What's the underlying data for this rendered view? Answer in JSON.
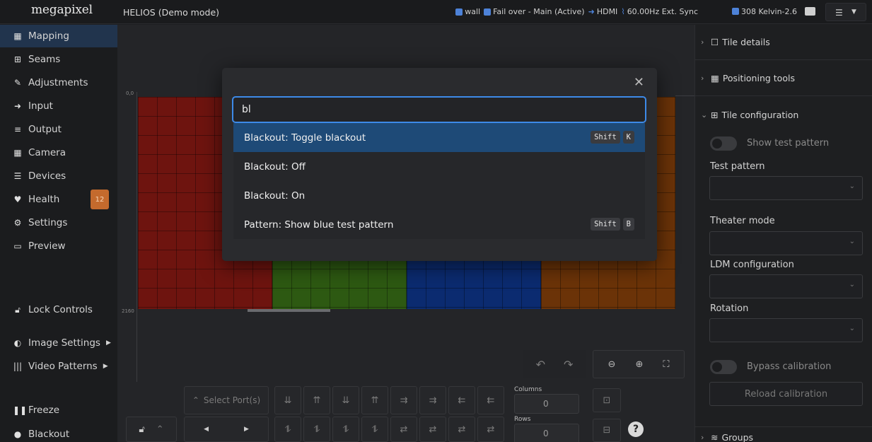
{
  "topbar": {
    "logo": "megapixel",
    "title": "HELIOS (Demo mode)",
    "status": {
      "wall": "wall",
      "failover": "Fail over - Main (Active)",
      "input": "HDMI",
      "sync": "60.00Hz Ext. Sync",
      "color_temp": "308 Kelvin-2.6"
    }
  },
  "sidebar": {
    "items": [
      {
        "label": "Mapping",
        "icon": "grid-icon"
      },
      {
        "label": "Seams",
        "icon": "plus-box-icon"
      },
      {
        "label": "Adjustments",
        "icon": "brush-icon"
      },
      {
        "label": "Input",
        "icon": "sign-in-icon"
      },
      {
        "label": "Output",
        "icon": "sliders-icon"
      },
      {
        "label": "Camera",
        "icon": "camera-grid-icon"
      },
      {
        "label": "Devices",
        "icon": "list-icon"
      },
      {
        "label": "Health",
        "icon": "heart-icon",
        "badge": "12"
      },
      {
        "label": "Settings",
        "icon": "gears-icon"
      },
      {
        "label": "Preview",
        "icon": "monitor-icon"
      }
    ],
    "lock_controls": "Lock Controls",
    "image_settings": "Image Settings",
    "video_patterns": "Video Patterns",
    "freeze": "Freeze",
    "blackout": "Blackout"
  },
  "canvas": {
    "ruler_top": "0,0",
    "ruler_bottom": "2160",
    "select_ports": "Select Port(s)",
    "columns_label": "Columns",
    "columns_value": "0",
    "rows_label": "Rows",
    "rows_value": "0",
    "help": "?"
  },
  "palette": {
    "query": "bl",
    "results": [
      {
        "label": "Blackout: Toggle blackout",
        "keys": [
          "Shift",
          "K"
        ],
        "selected": true
      },
      {
        "label": "Blackout: Off",
        "keys": [],
        "selected": false
      },
      {
        "label": "Blackout: On",
        "keys": [],
        "selected": false
      },
      {
        "label": "Pattern: Show blue test pattern",
        "keys": [
          "Shift",
          "B"
        ],
        "selected": false
      }
    ],
    "close": "✕"
  },
  "right_panel": {
    "tile_details": "Tile details",
    "positioning_tools": "Positioning tools",
    "tile_configuration": "Tile configuration",
    "show_test_pattern": "Show test pattern",
    "test_pattern": "Test pattern",
    "theater_mode": "Theater mode",
    "ldm_configuration": "LDM configuration",
    "rotation": "Rotation",
    "bypass_calibration": "Bypass calibration",
    "reload_calibration": "Reload calibration",
    "groups": "Groups"
  },
  "colors": {
    "accent": "#3d8ae8",
    "selected_row": "#1e4a77",
    "badge": "#c46a2d",
    "wall_red": "#7a1510",
    "wall_green": "#2b5a12",
    "wall_blue": "#0b2a6e",
    "wall_orange": "#7a3a08"
  }
}
